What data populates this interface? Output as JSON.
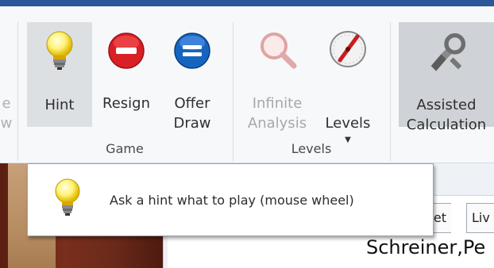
{
  "ribbon": {
    "cut_button_label": "e\nw",
    "game_group": {
      "label": "Game",
      "hint_label": "Hint",
      "resign_label": "Resign",
      "offer_draw_label": "Offer\nDraw"
    },
    "levels_group": {
      "label": "Levels",
      "infinite_analysis_label": "Infinite\nAnalysis",
      "levels_label": "Levels"
    },
    "assisted_calculation_label": "Assisted\nCalculation"
  },
  "tooltip": {
    "text": "Ask a hint what to play (mouse wheel)"
  },
  "pane": {
    "tabs": [
      "eet",
      "Liv"
    ],
    "player_name": "Schreiner,Pe"
  },
  "colors": {
    "title_bar": "#2b579a",
    "resign_red": "#d92027",
    "draw_blue": "#1565c0"
  }
}
